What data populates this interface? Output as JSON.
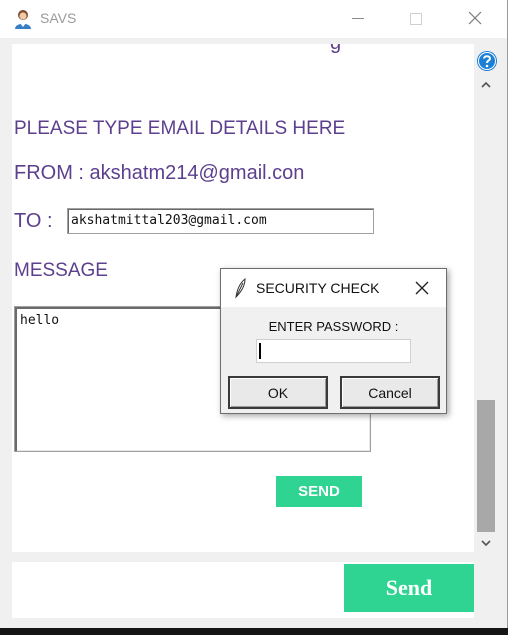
{
  "window": {
    "title": "SAVS",
    "icons": {
      "app": "user-avatar-icon",
      "minimize": "minimize-icon",
      "maximize": "maximize-icon",
      "close": "close-icon"
    }
  },
  "form": {
    "cut_text": "g",
    "heading": "PLEASE TYPE EMAIL DETAILS HERE",
    "from_text": "FROM : akshatm214@gmail.con",
    "to_label": "TO :",
    "to_value": "akshatmittal203@gmail.com",
    "message_label": "MESSAGE",
    "message_value": "hello",
    "send_small_label": "SEND"
  },
  "scrollbar": {
    "help_icon": "question-mark-icon",
    "up_icon": "chevron-up-icon",
    "down_icon": "chevron-down-icon"
  },
  "bottom": {
    "send_label": "Send"
  },
  "dialog": {
    "title": "SECURITY CHECK",
    "icon": "feather-icon",
    "password_label": "ENTER PASSWORD :",
    "password_value": "",
    "ok_label": "OK",
    "cancel_label": "Cancel"
  },
  "colors": {
    "accent_green": "#2fd493",
    "label_purple": "#5c3f8e",
    "help_blue": "#1c7fd6"
  }
}
